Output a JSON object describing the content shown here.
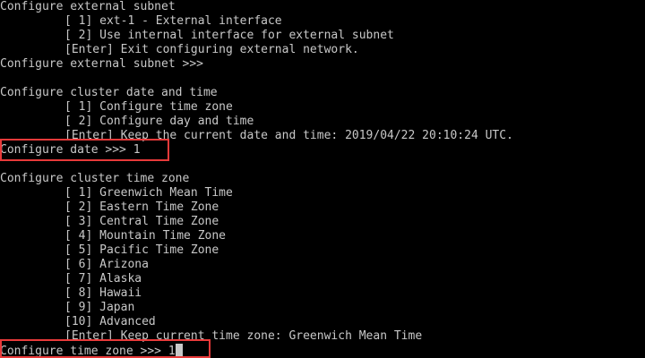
{
  "external_subnet": {
    "heading": "Configure external subnet",
    "options": [
      "[ 1] ext-1 - External interface",
      "[ 2] Use internal interface for external subnet",
      "[Enter] Exit configuring external network."
    ],
    "prompt": "Configure external subnet >>>"
  },
  "date_time": {
    "heading": "Configure cluster date and time",
    "options": [
      "[ 1] Configure time zone",
      "[ 2] Configure day and time",
      "[Enter] Keep the current date and time: 2019/04/22 20:10:24 UTC."
    ],
    "prompt": "Configure date >>> 1"
  },
  "time_zone": {
    "heading": "Configure cluster time zone",
    "options": [
      "[ 1] Greenwich Mean Time",
      "[ 2] Eastern Time Zone",
      "[ 3] Central Time Zone",
      "[ 4] Mountain Time Zone",
      "[ 5] Pacific Time Zone",
      "[ 6] Arizona",
      "[ 7] Alaska",
      "[ 8] Hawaii",
      "[ 9] Japan",
      "[10] Advanced",
      "[Enter] Keep current time zone: Greenwich Mean Time"
    ],
    "prompt": "Configure time zone >>> 1"
  },
  "colors": {
    "background": "#000000",
    "text": "#c8c8c8",
    "highlight": "#e83a3a"
  }
}
